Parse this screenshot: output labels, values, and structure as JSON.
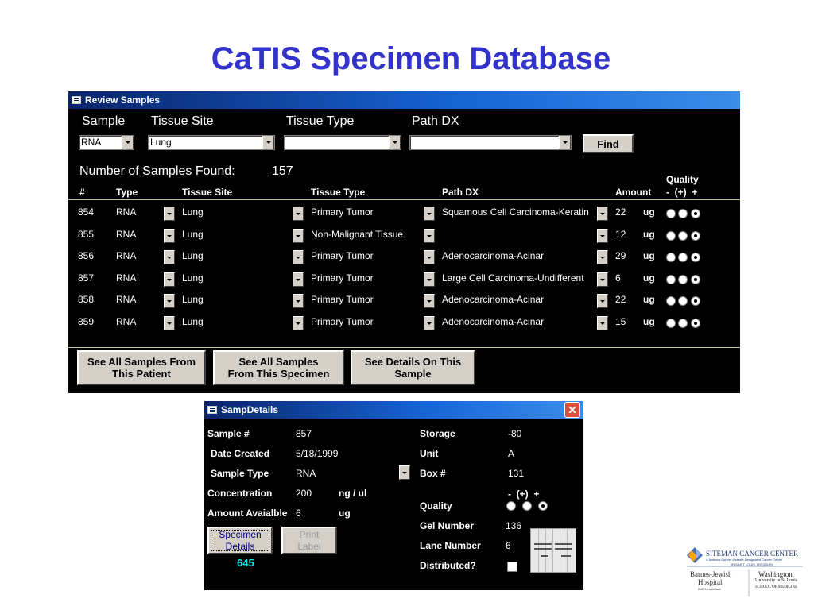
{
  "slide": {
    "title": "CaTIS Specimen Database"
  },
  "review": {
    "window_title": "Review Samples",
    "filter_labels": {
      "sample": "Sample",
      "tissue_site": "Tissue Site",
      "tissue_type": "Tissue Type",
      "path_dx": "Path DX"
    },
    "filters": {
      "sample": "RNA",
      "tissue_site": "Lung",
      "tissue_type": "",
      "path_dx": ""
    },
    "find_label": "Find",
    "count_label": "Number of Samples Found:",
    "count_value": "157",
    "columns": {
      "num": "#",
      "type": "Type",
      "tissue_site": "Tissue Site",
      "tissue_type": "Tissue Type",
      "path_dx": "Path DX",
      "amount": "Amount",
      "quality": "Quality",
      "quality_scale": "-  (+)  +"
    },
    "rows": [
      {
        "num": "854",
        "type": "RNA",
        "site": "Lung",
        "tissue_type": "Primary Tumor",
        "path_dx": "Squamous Cell Carcinoma-Keratin",
        "amount": "22",
        "unit": "ug"
      },
      {
        "num": "855",
        "type": "RNA",
        "site": "Lung",
        "tissue_type": "Non-Malignant Tissue",
        "path_dx": "",
        "amount": "12",
        "unit": "ug"
      },
      {
        "num": "856",
        "type": "RNA",
        "site": "Lung",
        "tissue_type": "Primary Tumor",
        "path_dx": "Adenocarcinoma-Acinar",
        "amount": "29",
        "unit": "ug"
      },
      {
        "num": "857",
        "type": "RNA",
        "site": "Lung",
        "tissue_type": "Primary Tumor",
        "path_dx": "Large Cell Carcinoma-Undifferent",
        "amount": "6",
        "unit": "ug"
      },
      {
        "num": "858",
        "type": "RNA",
        "site": "Lung",
        "tissue_type": "Primary Tumor",
        "path_dx": "Adenocarcinoma-Acinar",
        "amount": "22",
        "unit": "ug"
      },
      {
        "num": "859",
        "type": "RNA",
        "site": "Lung",
        "tissue_type": "Primary Tumor",
        "path_dx": "Adenocarcinoma-Acinar",
        "amount": "15",
        "unit": "ug"
      }
    ],
    "buttons": {
      "patient": "See All Samples From\nThis Patient",
      "specimen": "See All Samples\nFrom This Specimen",
      "details": "See Details On This\nSample"
    }
  },
  "details": {
    "window_title": "SampDetails",
    "close_glyph": "✕",
    "sample_label": "Sample #",
    "sample": "857",
    "date_label": "Date Created",
    "date": "5/18/1999",
    "type_label": "Sample Type",
    "type": "RNA",
    "conc_label": "Concentration",
    "conc": "200",
    "conc_unit": "ng / ul",
    "amount_label": "Amount Avaialble",
    "amount": "6",
    "amount_unit": "ug",
    "storage_label": "Storage",
    "storage": "-80",
    "unit_label": "Unit",
    "unit": "A",
    "box_label": "Box #",
    "box": "131",
    "quality_label": "Quality",
    "quality_scale": "-  (+)  +",
    "gel_label": "Gel Number",
    "gel": "136",
    "lane_label": "Lane Number",
    "lane": "6",
    "distributed_label": "Distributed?",
    "specimen_btn": "Specimen\nDetails",
    "print_btn": "Print\nLabel",
    "specimen_id": "645"
  },
  "logo": {
    "line1": "SITEMAN CANCER CENTER",
    "line2": "A National Cancer Institute-Designated Cancer Center",
    "line3": "IN SAINT LOUIS, MISSOURI",
    "bjh1": "Barnes-Jewish",
    "bjh2": "Hospital",
    "bjh3": "BJC HealthCare",
    "wu1": "Washington",
    "wu2": "University in St.Louis",
    "wu3": "SCHOOL OF MEDICINE"
  },
  "colors": {
    "title": "#3333cc",
    "titlebar": "#0a246a",
    "accent_cyan": "#00e5e5"
  },
  "icons": [
    "form-icon",
    "dropdown-arrow-icon",
    "close-icon",
    "gel-image-icon",
    "siteman-logo-icon"
  ]
}
